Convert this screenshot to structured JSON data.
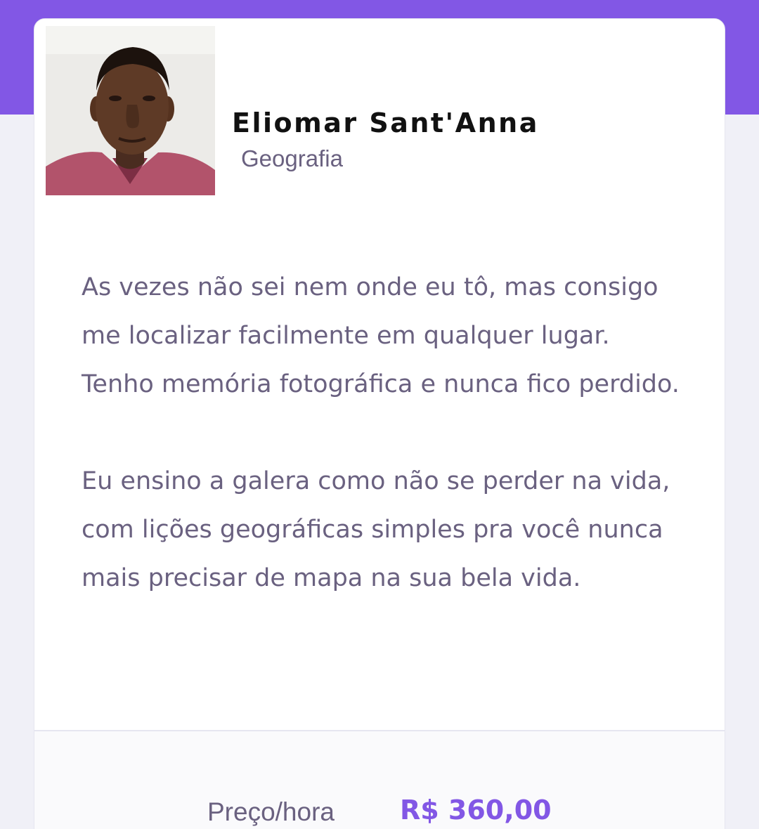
{
  "teacher": {
    "name": "Eliomar Sant'Anna",
    "subject": "Geografia",
    "bio": [
      "As vezes não sei nem onde eu tô, mas consigo me localizar facilmente em qualquer lugar. Tenho memória fotográfica e nunca fico perdido.",
      "Eu ensino a galera como não se perder na vida, com lições geográficas simples pra você nunca mais precisar de mapa na sua bela vida."
    ]
  },
  "footer": {
    "price_label": "Preço/hora",
    "price_value": "R$ 360,00"
  },
  "colors": {
    "accent": "#8257e5",
    "background": "#f0f0f7",
    "text_muted": "#6a6180"
  }
}
